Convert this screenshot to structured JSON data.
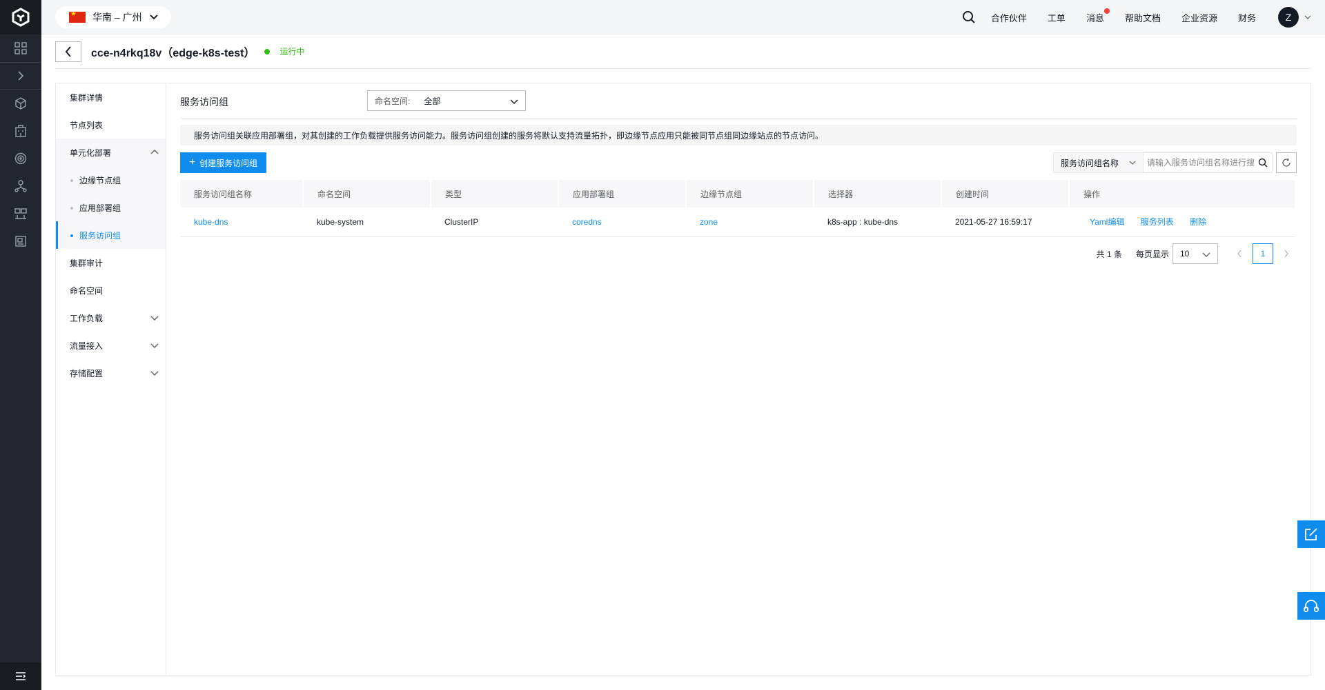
{
  "topbar": {
    "region": "华南 – 广州",
    "nav": [
      "合作伙伴",
      "工单",
      "消息",
      "帮助文档",
      "企业资源",
      "财务"
    ],
    "avatar": "Z"
  },
  "header": {
    "cluster": "cce-n4rkq18v（edge-k8s-test）",
    "status": "运行中"
  },
  "subnav": {
    "items": [
      "集群详情",
      "节点列表",
      "单元化部署",
      "边缘节点组",
      "应用部署组",
      "服务访问组",
      "集群审计",
      "命名空间",
      "工作负载",
      "流量接入",
      "存储配置"
    ]
  },
  "content": {
    "title": "服务访问组",
    "namespace_label": "命名空间:",
    "namespace_value": "全部",
    "tip": "服务访问组关联应用部署组，对其创建的工作负载提供服务访问能力。服务访问组创建的服务将默认支持流量拓扑，即边缘节点应用只能被同节点组同边缘站点的节点访问。",
    "create_label": "创建服务访问组",
    "search_field": "服务访问组名称",
    "search_placeholder": "请输入服务访问组名称进行搜索"
  },
  "table": {
    "headers": [
      "服务访问组名称",
      "命名空间",
      "类型",
      "应用部署组",
      "边缘节点组",
      "选择器",
      "创建时间",
      "操作"
    ],
    "rows": [
      {
        "name": "kube-dns",
        "namespace": "kube-system",
        "type": "ClusterIP",
        "deploy_group": "coredns",
        "edge_group": "zone",
        "selector": "k8s-app : kube-dns",
        "created": "2021-05-27 16:59:17",
        "ops": [
          "Yaml编辑",
          "服务列表",
          "删除"
        ]
      }
    ]
  },
  "pager": {
    "total": "共 1 条",
    "per_page_label": "每页显示",
    "per_page": "10",
    "page": "1"
  },
  "colors": {
    "accent": "#108cee",
    "running": "#30bf13",
    "rail": "#23262e"
  }
}
